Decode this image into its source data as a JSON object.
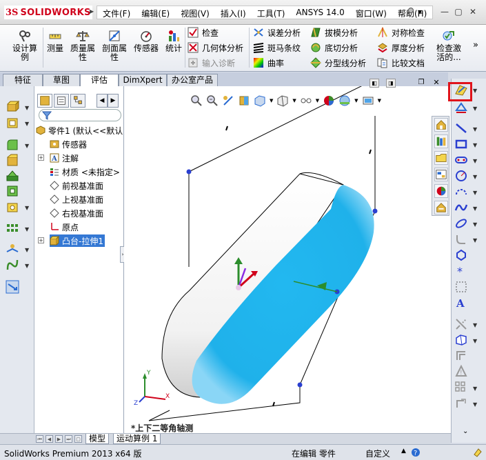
{
  "app": {
    "logo_prefix": "3S",
    "logo_text": "SOLIDWORKS",
    "menus": [
      "文件(F)",
      "编辑(E)",
      "视图(V)",
      "插入(I)",
      "工具(T)",
      "ANSYS 14.0",
      "窗口(W)",
      "帮助(H)"
    ]
  },
  "ribbon": {
    "design_study": "设计算\n例",
    "measure": "测量",
    "mass_props": "质量属\n性",
    "section_props": "剖面属\n性",
    "sensor": "传感器",
    "statistics": "统计",
    "check": "检查",
    "geometry_analysis": "几何体分析",
    "import_diag": "输入诊断",
    "deviation_analysis": "误差分析",
    "zebra": "斑马条纹",
    "curvature": "曲率",
    "draft_analysis": "拔模分析",
    "undercut": "底切分析",
    "parting_line": "分型线分析",
    "symmetry": "对称检查",
    "thickness": "厚度分析",
    "compare": "比较文档",
    "check_active": "检查激\n活的..."
  },
  "command_tabs": [
    "特征",
    "草图",
    "评估",
    "DimXpert",
    "办公室产品"
  ],
  "active_tab_index": 2,
  "tree": {
    "root": "零件1 (默认<<默认",
    "items": [
      "传感器",
      "注解",
      "材质 <未指定>",
      "前视基准面",
      "上视基准面",
      "右视基准面",
      "原点",
      "凸台-拉伸1"
    ]
  },
  "graphics": {
    "view_label": "*上下二等角轴测",
    "part_color": "#1fb1ea"
  },
  "bottom_tabs": [
    "模型",
    "运动算例 1"
  ],
  "status": {
    "product": "SolidWorks Premium 2013 x64 版",
    "edit_state": "在编辑 零件",
    "custom": "自定义"
  },
  "colors": {
    "highlight": "#e0131b",
    "selection": "#3478d4"
  }
}
